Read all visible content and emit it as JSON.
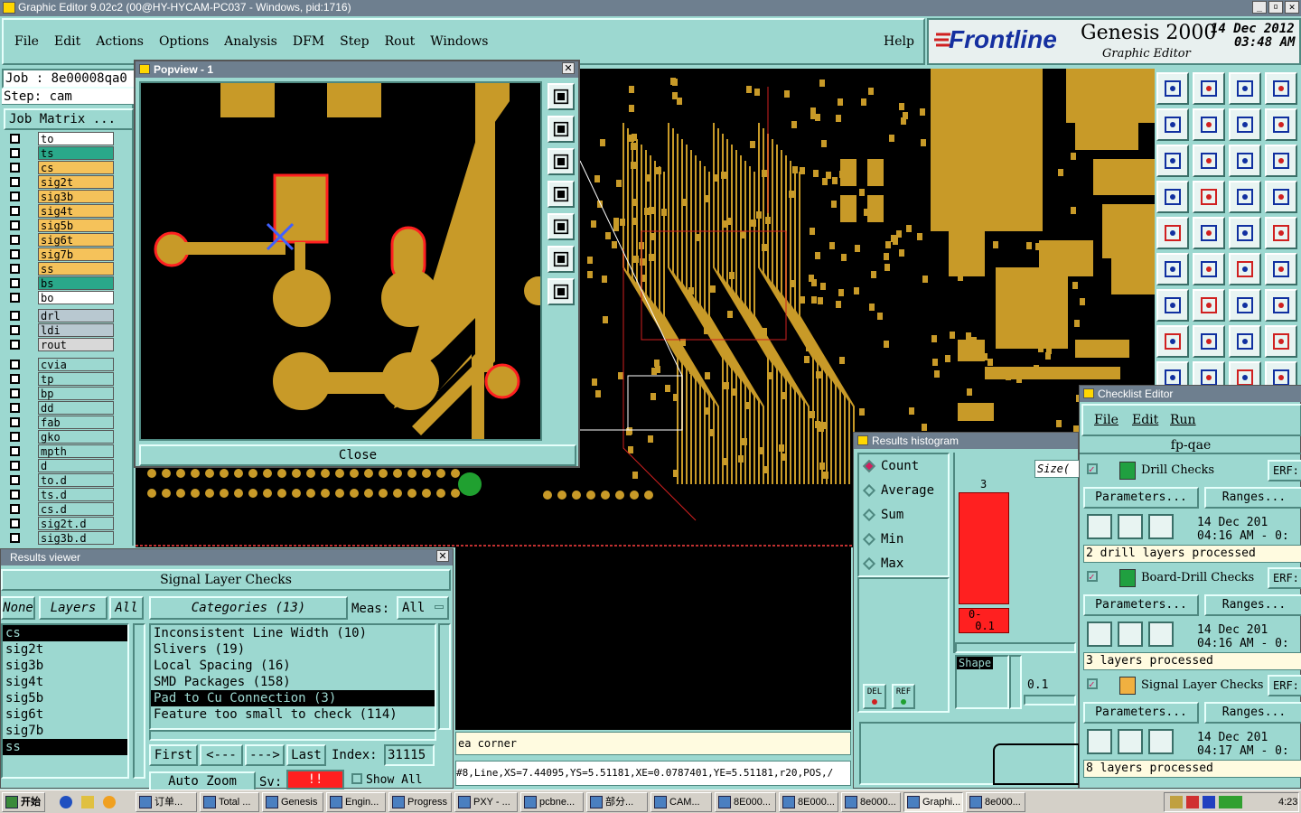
{
  "window": {
    "title": "Graphic Editor 9.02c2 (00@HY-HYCAM-PC037 - Windows, pid:1716)"
  },
  "menubar": {
    "items": [
      "File",
      "Edit",
      "Actions",
      "Options",
      "Analysis",
      "DFM",
      "Step",
      "Rout",
      "Windows"
    ],
    "help": "Help"
  },
  "brand": {
    "logo": "Frontline",
    "product": "Genesis 2000",
    "subtitle": "Graphic Editor",
    "date": "14 Dec 2012",
    "time": "03:48 AM"
  },
  "job": {
    "job_label": "Job : 8e00008qa0",
    "step_label": "Step: cam",
    "matrix_button": "Job Matrix ..."
  },
  "layers": [
    {
      "name": "to",
      "color": "#ffffff"
    },
    {
      "name": "ts",
      "color": "#2aa88a"
    },
    {
      "name": "cs",
      "color": "#f5c25a"
    },
    {
      "name": "sig2t",
      "color": "#f5c25a"
    },
    {
      "name": "sig3b",
      "color": "#f5c25a"
    },
    {
      "name": "sig4t",
      "color": "#f5c25a"
    },
    {
      "name": "sig5b",
      "color": "#f5c25a"
    },
    {
      "name": "sig6t",
      "color": "#f5c25a"
    },
    {
      "name": "sig7b",
      "color": "#f5c25a"
    },
    {
      "name": "ss",
      "color": "#f5c25a"
    },
    {
      "name": "bs",
      "color": "#2aa88a"
    },
    {
      "name": "bo",
      "color": "#ffffff"
    }
  ],
  "layers2": [
    {
      "name": "drl",
      "color": "#b8c8d0"
    },
    {
      "name": "ldi",
      "color": "#b8c8d0"
    },
    {
      "name": "rout",
      "color": "#d8d8d8"
    }
  ],
  "layers3": [
    {
      "name": "cvia"
    },
    {
      "name": "tp"
    },
    {
      "name": "bp"
    },
    {
      "name": "dd"
    },
    {
      "name": "fab"
    },
    {
      "name": "gko"
    },
    {
      "name": "mpth"
    },
    {
      "name": "d"
    },
    {
      "name": "to.d"
    },
    {
      "name": "ts.d"
    },
    {
      "name": "cs.d"
    },
    {
      "name": "sig2t.d"
    },
    {
      "name": "sig3b.d"
    }
  ],
  "popview": {
    "title": "Popview - 1",
    "close_button": "Close"
  },
  "results_viewer": {
    "title": "Results viewer",
    "heading": "Signal Layer Checks",
    "none_button": "None",
    "layers_button": "Layers",
    "all_button": "All",
    "categories_button": "Categories (13)",
    "meas_label": "Meas:",
    "meas_value": "All",
    "layer_list": [
      "cs",
      "sig2t",
      "sig3b",
      "sig4t",
      "sig5b",
      "sig6t",
      "sig7b",
      "ss"
    ],
    "categories": [
      "Inconsistent Line Width (10)",
      "Slivers (19)",
      "Local Spacing (16)",
      "SMD Packages (158)",
      "Pad to Cu Connection (3)",
      "Feature too small to check (114)"
    ],
    "first_button": "First",
    "prev_button": "<---",
    "next_button": "--->",
    "last_button": "Last",
    "index_label": "Index:",
    "index_value": "31115",
    "auto_zoom": "Auto Zoom",
    "sv_label": "Sv:",
    "sv_value": "!!",
    "show_all": "Show All"
  },
  "status": {
    "message": "ea corner",
    "feature": "#8,Line,XS=7.44095,YS=5.51181,XE=0.0787401,YE=5.51181,r20,POS,/"
  },
  "histogram": {
    "title": "Results histogram",
    "options": [
      "Count",
      "Average",
      "Sum",
      "Min",
      "Max"
    ],
    "selected": "Count",
    "size_label": "Size(",
    "bar_value": "3",
    "bar_range": "0-\n 0.1",
    "shape_label": "Shape",
    "scale_value": "0.1",
    "del_button": "DEL",
    "ref_button": "REF"
  },
  "checklist": {
    "title": "Checklist Editor",
    "menu": [
      "File",
      "Edit",
      "Run"
    ],
    "name": "fp-qae",
    "params_label": "Parameters...",
    "ranges_label": "Ranges...",
    "erf_label": "ERF:",
    "checks": [
      {
        "name": "Drill Checks",
        "date": "14 Dec 201",
        "time": "04:16 AM - 0:",
        "status": "2 drill layers processed"
      },
      {
        "name": "Board-Drill Checks",
        "date": "14 Dec 201",
        "time": "04:16 AM - 0:",
        "status": "3 layers processed"
      },
      {
        "name": "Signal Layer Checks",
        "date": "14 Dec 201",
        "time": "04:17 AM - 0:",
        "status": "8 layers processed"
      }
    ]
  },
  "taskbar": {
    "start": "开始",
    "items": [
      "订单...",
      "Total ...",
      "Genesis",
      "Engin...",
      "Progress",
      "PXY - ...",
      "pcbne...",
      "部分...",
      "CAM...",
      "8E000...",
      "8E000...",
      "8e000...",
      "Graphi...",
      "8e000..."
    ],
    "clock": "4:23"
  },
  "colors": {
    "copper": "#c89a28",
    "teal": "#9cd8d0",
    "highlight": "#ff2020"
  }
}
